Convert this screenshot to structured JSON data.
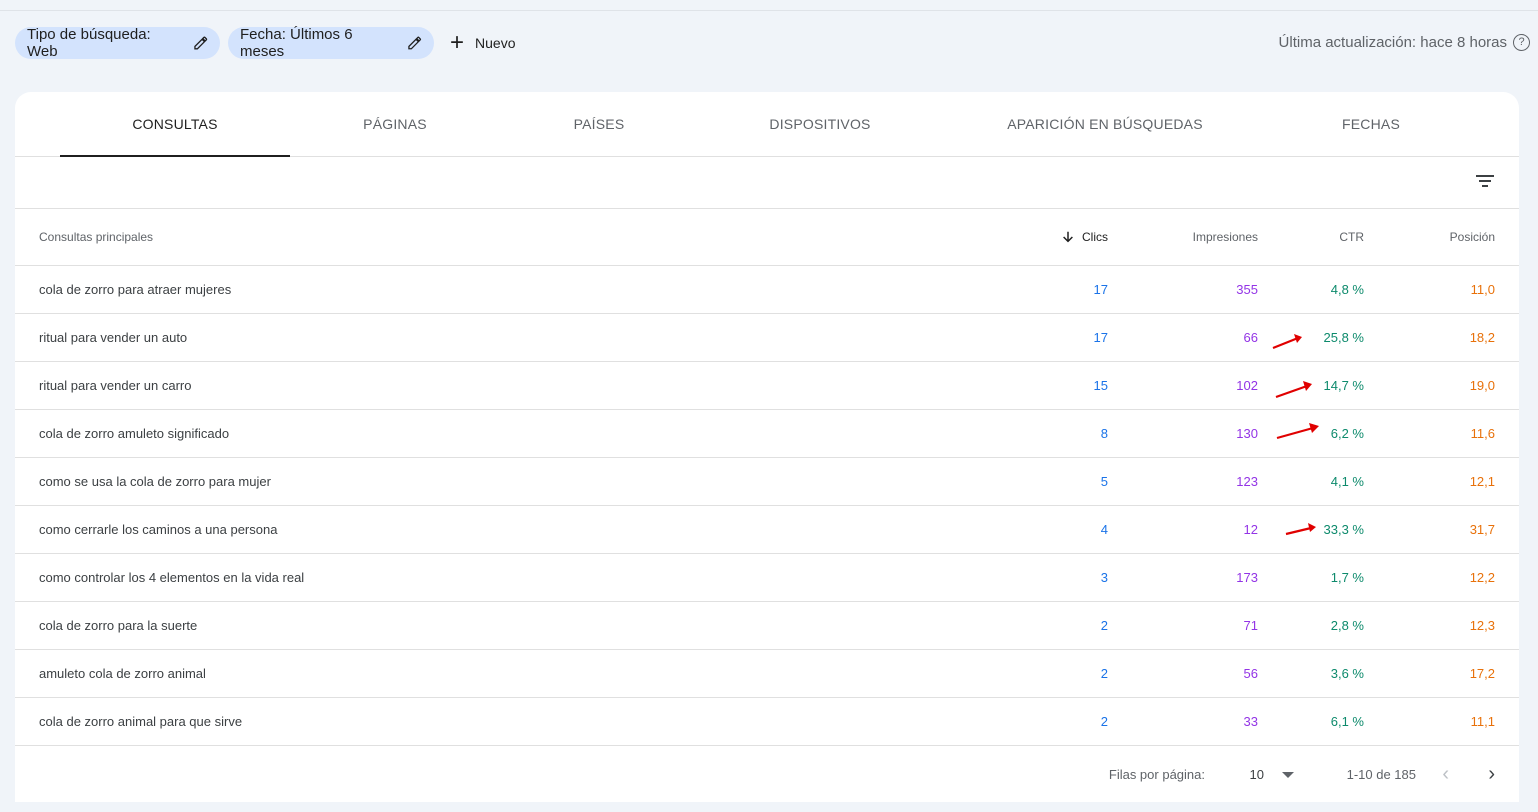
{
  "filters": {
    "search_type": "Tipo de búsqueda: Web",
    "date": "Fecha: Últimos 6 meses",
    "new_label": "Nuevo"
  },
  "last_update": "Última actualización: hace 8 horas",
  "tabs": [
    "CONSULTAS",
    "PÁGINAS",
    "PAÍSES",
    "DISPOSITIVOS",
    "APARICIÓN EN BÚSQUEDAS",
    "FECHAS"
  ],
  "table": {
    "headers": {
      "query": "Consultas principales",
      "clicks": "Clics",
      "impressions": "Impresiones",
      "ctr": "CTR",
      "position": "Posición"
    },
    "rows": [
      {
        "query": "cola de zorro para atraer mujeres",
        "clicks": "17",
        "impressions": "355",
        "ctr": "4,8 %",
        "position": "11,0"
      },
      {
        "query": "ritual para vender un auto",
        "clicks": "17",
        "impressions": "66",
        "ctr": "25,8 %",
        "position": "18,2"
      },
      {
        "query": "ritual para vender un carro",
        "clicks": "15",
        "impressions": "102",
        "ctr": "14,7 %",
        "position": "19,0"
      },
      {
        "query": "cola de zorro amuleto significado",
        "clicks": "8",
        "impressions": "130",
        "ctr": "6,2 %",
        "position": "11,6"
      },
      {
        "query": "como se usa la cola de zorro para mujer",
        "clicks": "5",
        "impressions": "123",
        "ctr": "4,1 %",
        "position": "12,1"
      },
      {
        "query": "como cerrarle los caminos a una persona",
        "clicks": "4",
        "impressions": "12",
        "ctr": "33,3 %",
        "position": "31,7"
      },
      {
        "query": "como controlar los 4 elementos en la vida real",
        "clicks": "3",
        "impressions": "173",
        "ctr": "1,7 %",
        "position": "12,2"
      },
      {
        "query": "cola de zorro para la suerte",
        "clicks": "2",
        "impressions": "71",
        "ctr": "2,8 %",
        "position": "12,3"
      },
      {
        "query": "amuleto cola de zorro animal",
        "clicks": "2",
        "impressions": "56",
        "ctr": "3,6 %",
        "position": "17,2"
      },
      {
        "query": "cola de zorro animal para que sirve",
        "clicks": "2",
        "impressions": "33",
        "ctr": "6,1 %",
        "position": "11,1"
      }
    ]
  },
  "pagination": {
    "rows_label": "Filas por página:",
    "rows_value": "10",
    "range": "1-10 de 185"
  },
  "colors": {
    "clicks": "#1a73e8",
    "impressions": "#9334e6",
    "ctr": "#0d8a6c",
    "position": "#e8710a",
    "annotation_arrow": "#e00000"
  },
  "icons": [
    "edit-icon",
    "add-icon",
    "help-icon",
    "filter-icon",
    "arrow-down-icon",
    "chevron-left-icon",
    "chevron-right-icon"
  ]
}
